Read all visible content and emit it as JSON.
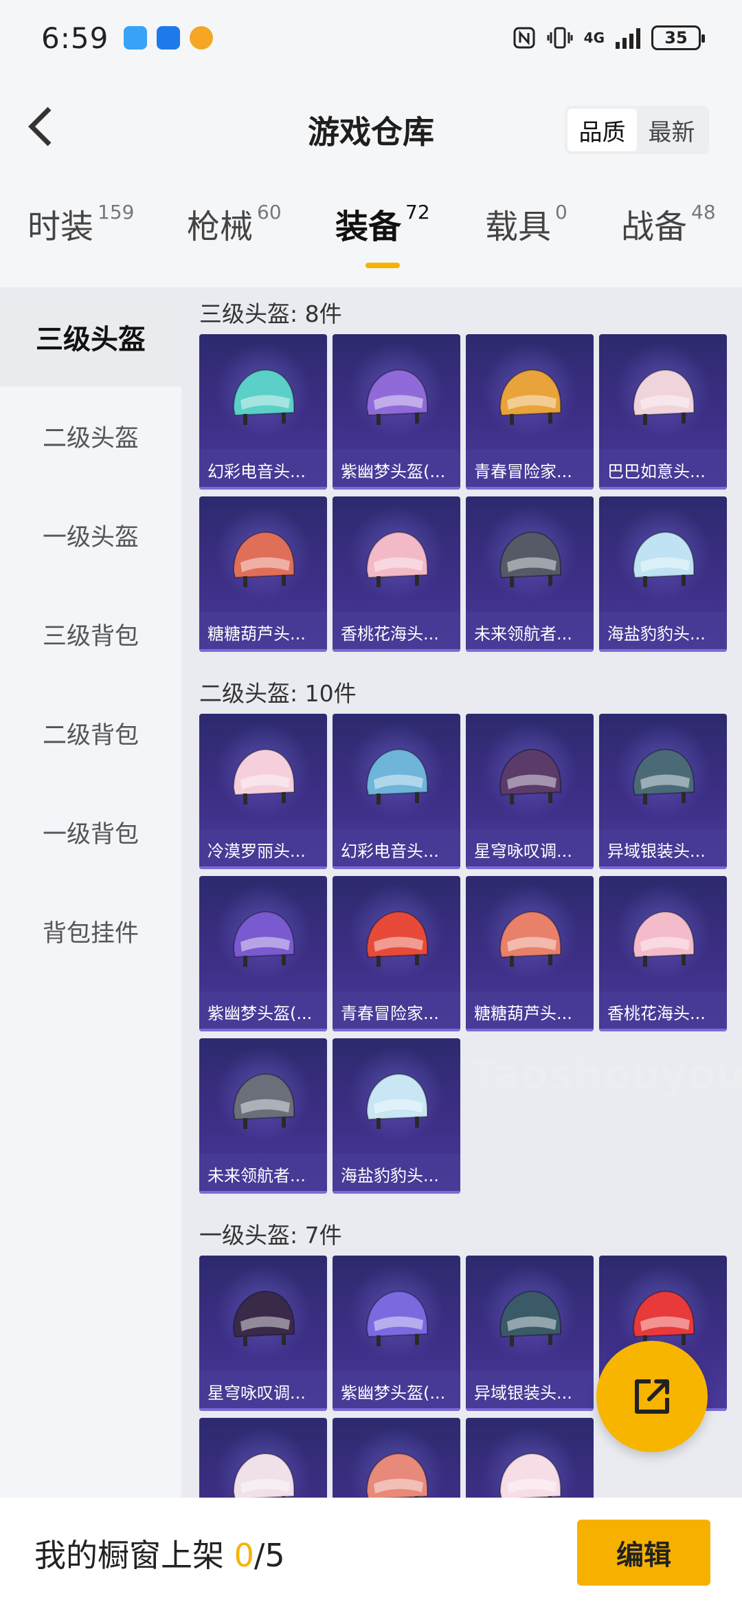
{
  "status_bar": {
    "time": "6:59",
    "network": "4G",
    "battery": "35",
    "app_icons": [
      "app-icon-1",
      "app-icon-2",
      "app-icon-3"
    ]
  },
  "header": {
    "title": "游戏仓库",
    "sort_options": [
      "品质",
      "最新"
    ],
    "active_sort": "品质"
  },
  "tabs": [
    {
      "label": "时装",
      "count": "159"
    },
    {
      "label": "枪械",
      "count": "60"
    },
    {
      "label": "装备",
      "count": "72"
    },
    {
      "label": "载具",
      "count": "0"
    },
    {
      "label": "战备",
      "count": "48"
    }
  ],
  "active_tab": "装备",
  "sidebar": {
    "items": [
      "三级头盔",
      "二级头盔",
      "一级头盔",
      "三级背包",
      "二级背包",
      "一级背包",
      "背包挂件"
    ],
    "active": "三级头盔"
  },
  "sections": [
    {
      "title": "三级头盔: 8件",
      "items": [
        {
          "name": "幻彩电音头...",
          "color": "#5ad0c8"
        },
        {
          "name": "紫幽梦头盔(...",
          "color": "#8f6ad8"
        },
        {
          "name": "青春冒险家...",
          "color": "#e8a33a"
        },
        {
          "name": "巴巴如意头...",
          "color": "#f0d4dc"
        },
        {
          "name": "糖糖葫芦头...",
          "color": "#e06f5a"
        },
        {
          "name": "香桃花海头...",
          "color": "#f3b9c6"
        },
        {
          "name": "未来领航者...",
          "color": "#555a66"
        },
        {
          "name": "海盐豹豹头...",
          "color": "#bfe3f2"
        }
      ]
    },
    {
      "title": "二级头盔: 10件",
      "items": [
        {
          "name": "冷漠罗丽头...",
          "color": "#f5d0dc"
        },
        {
          "name": "幻彩电音头...",
          "color": "#6fb4d9"
        },
        {
          "name": "星穹咏叹调...",
          "color": "#5a3b6a"
        },
        {
          "name": "异域银装头...",
          "color": "#4a6a78"
        },
        {
          "name": "紫幽梦头盔(...",
          "color": "#7a5ad0"
        },
        {
          "name": "青春冒险家...",
          "color": "#e84a3a"
        },
        {
          "name": "糖糖葫芦头...",
          "color": "#e8806a"
        },
        {
          "name": "香桃花海头...",
          "color": "#f4bccb"
        },
        {
          "name": "未来领航者...",
          "color": "#6a6f7a"
        },
        {
          "name": "海盐豹豹头...",
          "color": "#c8e6f4"
        }
      ]
    },
    {
      "title": "一级头盔: 7件",
      "items": [
        {
          "name": "星穹咏叹调...",
          "color": "#3a2a4a"
        },
        {
          "name": "紫幽梦头盔(...",
          "color": "#7a6ae0"
        },
        {
          "name": "异域银装头...",
          "color": "#3a5a68"
        },
        {
          "name": "",
          "color": "#e83a3a"
        },
        {
          "name": "",
          "color": "#f0e0ea"
        },
        {
          "name": "",
          "color": "#e88a7a"
        },
        {
          "name": "",
          "color": "#f6dde6"
        }
      ]
    }
  ],
  "watermark": "Taoshouyou.Com",
  "bottom_bar": {
    "label": "我的橱窗上架",
    "count": "0",
    "total": "/5",
    "edit_label": "编辑"
  },
  "colors": {
    "accent": "#f6b100",
    "card_bg": "#3d2f86"
  }
}
